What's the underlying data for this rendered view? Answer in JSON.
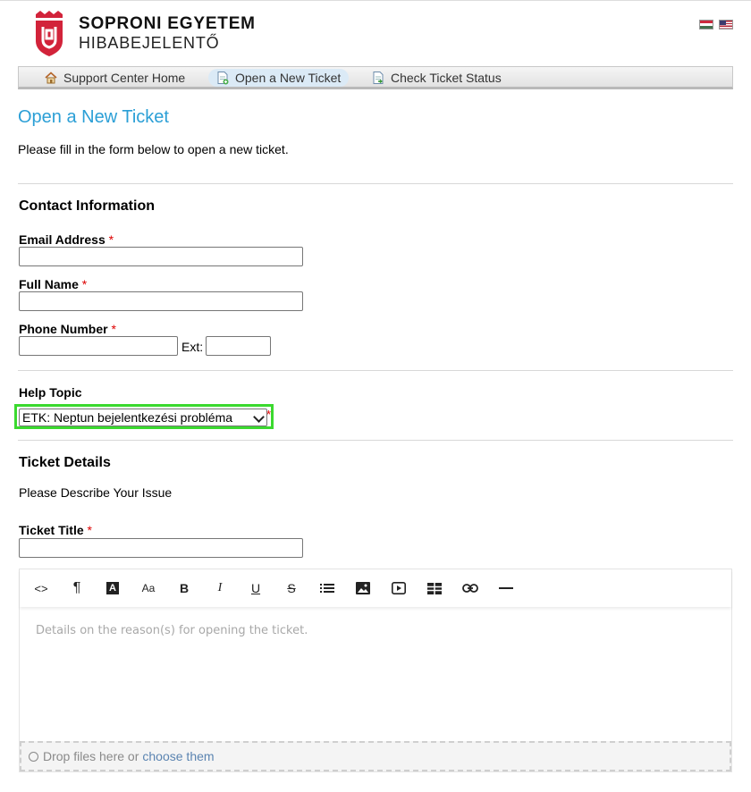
{
  "header": {
    "brand_line1": "SOPRONI EGYETEM",
    "brand_line2": "HIBABEJELENTŐ",
    "brand_color": "#d2233a"
  },
  "nav": [
    {
      "label": "Support Center Home",
      "icon": "home-icon"
    },
    {
      "label": "Open a New Ticket",
      "icon": "new-ticket-icon",
      "active": true
    },
    {
      "label": "Check Ticket Status",
      "icon": "ticket-status-icon"
    }
  ],
  "page": {
    "title": "Open a New Ticket",
    "intro": "Please fill in the form below to open a new ticket."
  },
  "contact": {
    "title": "Contact Information",
    "email_label": "Email Address",
    "name_label": "Full Name",
    "phone_label": "Phone Number",
    "ext_label": "Ext:",
    "required_mark": "*"
  },
  "help_topic": {
    "label": "Help Topic",
    "selected": "ETK: Neptun bejelentkezési probléma",
    "highlight_color": "#3bd92f"
  },
  "details": {
    "title": "Ticket Details",
    "subtitle": "Please Describe Your Issue",
    "ticket_title_label": "Ticket Title",
    "editor_placeholder": "Details on the reason(s) for opening the ticket.",
    "drop_text": "Drop files here or",
    "drop_link": "choose them"
  },
  "toolbar": {
    "code": "<>",
    "paragraph": "¶",
    "font_color": "A",
    "font_size": "Aa",
    "bold": "B",
    "italic": "I",
    "underline": "U",
    "strike": "S"
  }
}
